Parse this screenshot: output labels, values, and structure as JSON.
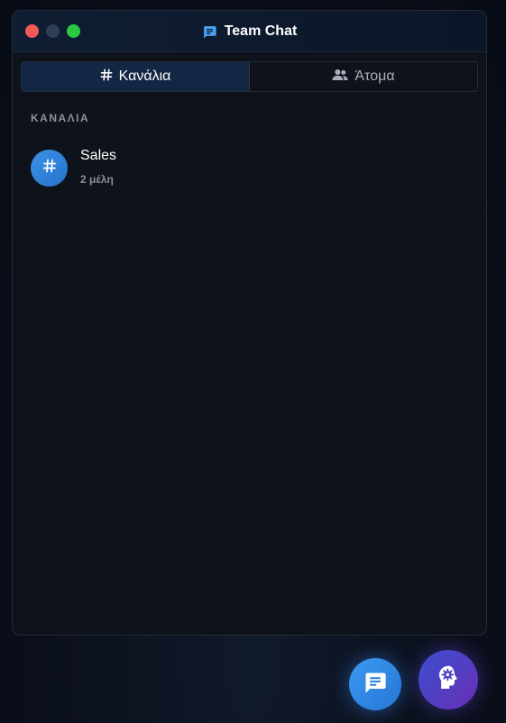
{
  "window": {
    "title": "Team Chat",
    "title_icon": "chat-bubble-icon"
  },
  "tabs": [
    {
      "label": "Κανάλια",
      "icon": "hash-icon",
      "active": true
    },
    {
      "label": "Άτομα",
      "icon": "people-icon",
      "active": false
    }
  ],
  "channels_section": {
    "label": "ΚΑΝΑΛΙΑ",
    "items": [
      {
        "name": "Sales",
        "members": "2 μέλη",
        "icon": "hash-icon"
      }
    ]
  },
  "fabs": {
    "chat": {
      "icon": "chat-bubble-icon"
    },
    "ai": {
      "icon": "head-gear-icon"
    }
  },
  "colors": {
    "accent": "#2f86e0",
    "window_bg": "#0e121b",
    "active_tab_bg": "#132643",
    "ai_gradient_start": "#3a4fcf",
    "ai_gradient_end": "#6a2fb6"
  }
}
